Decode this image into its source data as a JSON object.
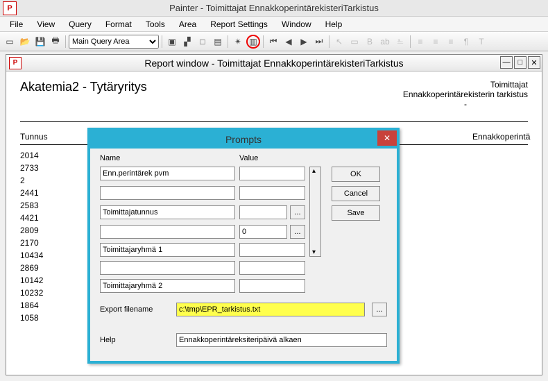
{
  "app": {
    "title": "Painter - Toimittajat EnnakkoperintärekisteriTarkistus",
    "logo": "P"
  },
  "menu": {
    "file": "File",
    "view": "View",
    "query": "Query",
    "format": "Format",
    "tools": "Tools",
    "area": "Area",
    "report": "Report Settings",
    "window": "Window",
    "help": "Help"
  },
  "toolbar": {
    "query_area": "Main Query Area"
  },
  "report_window": {
    "title": "Report window - Toimittajat EnnakkoperintärekisteriTarkistus",
    "left_title": "Akatemia2 - Tytäryritys",
    "right1": "Toimittajat",
    "right2": "Ennakkoperintärekisterin tarkistus",
    "right3": "-",
    "col1": "Tunnus",
    "col2": "Ennakkoperintä",
    "rows": [
      "2014",
      "2733",
      "2",
      "2441",
      "2583",
      "4421",
      "2809",
      "2170",
      "10434",
      "2869",
      "10142",
      "10232",
      "1864",
      "1058"
    ]
  },
  "prompts": {
    "title": "Prompts",
    "head_name": "Name",
    "head_value": "Value",
    "ok": "OK",
    "cancel": "Cancel",
    "save": "Save",
    "f1_name": "Enn.perintärek pvm",
    "f1_val": "",
    "f2_name": "",
    "f2_val": "",
    "f3_name": "Toimittajatunnus",
    "f3_val": "",
    "f4_name": "",
    "f4_val": "0",
    "f5_name": "Toimittajaryhmä 1",
    "f5_val": "",
    "f6_name": "",
    "f6_val": "",
    "f7_name": "Toimittajaryhmä 2",
    "f7_val": "",
    "export_label": "Export filename",
    "export_value": "c:\\tmp\\EPR_tarkistus.txt",
    "help_label": "Help",
    "help_value": "Ennakkoperintäreksiteripäivä alkaen"
  }
}
